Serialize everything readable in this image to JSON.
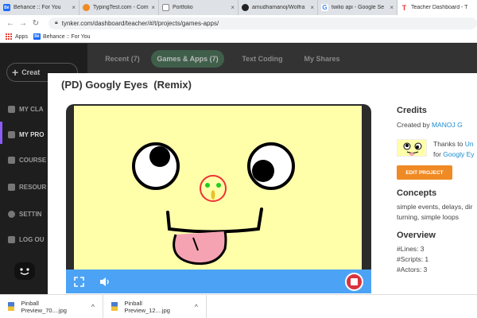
{
  "browser": {
    "tabs": [
      {
        "label": "Behance :: For You",
        "icon": "behance-icon",
        "icon_text": "Bē",
        "color": "#1769ff",
        "active": false
      },
      {
        "label": "TypingTest.com - Com",
        "icon": "typingtest-icon",
        "icon_text": "",
        "color": "#f08a24",
        "active": false
      },
      {
        "label": "Portfolio",
        "icon": "portfolio-icon",
        "icon_text": "",
        "color": "#888888",
        "active": false
      },
      {
        "label": "amudhamanoj/Wolfra",
        "icon": "github-icon",
        "icon_text": "",
        "color": "#222222",
        "active": false
      },
      {
        "label": "twilio api - Google Se",
        "icon": "google-icon",
        "icon_text": "G",
        "color": "#4285f4",
        "active": false
      },
      {
        "label": "Teacher Dashboard - T",
        "icon": "tynker-icon",
        "icon_text": "T",
        "color": "#e23a3a",
        "active": true
      }
    ],
    "url": "tynker.com/dashboard/teacher/#/t/projects/games-apps/",
    "bookmarks": {
      "apps": "Apps",
      "behance": "Behance :: For You"
    }
  },
  "app": {
    "create_label": "Creat",
    "sidebar": [
      "MY CLA",
      "MY PRO",
      "COURSE",
      "RESOUR",
      "SETTIN",
      "LOG OU"
    ],
    "nav_tabs": [
      "Recent (7)",
      "Games & Apps (7)",
      "Text Coding",
      "My Shares"
    ]
  },
  "modal": {
    "title": "(PD) Googly Eyes  (Remix)",
    "credits_heading": "Credits",
    "created_by_prefix": "Created by ",
    "created_by_name": "MANOJ G",
    "thanks_prefix": "Thanks to ",
    "thanks_name": "Un",
    "for_prefix": "for ",
    "for_project": "Googly Ey",
    "edit_button": "EDIT PROJECT",
    "concepts_heading": "Concepts",
    "concepts_line1": "simple events, delays, dir",
    "concepts_line2": "turning, simple loops",
    "overview_heading": "Overview",
    "lines": "#Lines: 3",
    "scripts": "#Scripts: 1",
    "actors": "#Actors: 3"
  },
  "downloads": [
    {
      "file": "Pinball Preview_70....jpg"
    },
    {
      "file": "Pinball Preview_12....jpg"
    }
  ],
  "colors": {
    "accent": "#4ca3f5",
    "edit": "#f08a24",
    "stop": "#d9333f",
    "stage": "#ffffaa"
  }
}
